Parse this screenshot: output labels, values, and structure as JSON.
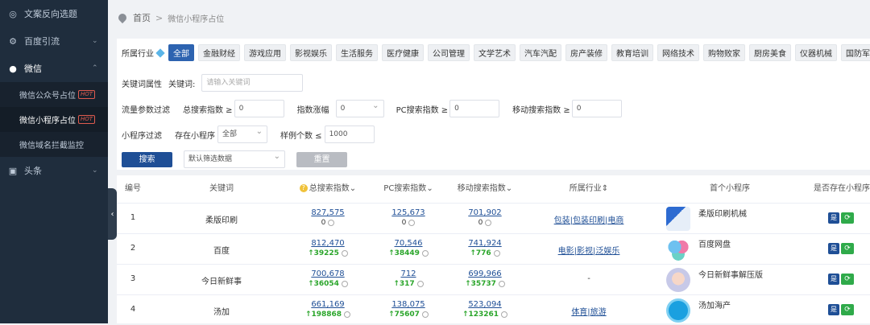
{
  "sidebar": {
    "items": [
      {
        "label": "文案反向选题",
        "icon": "target-icon"
      },
      {
        "label": "百度引流",
        "icon": "gear-icon"
      },
      {
        "label": "微信",
        "icon": "chat-icon"
      },
      {
        "label": "头条",
        "icon": "card-icon"
      }
    ],
    "wechat_sub": [
      {
        "label": "微信公众号占位",
        "badge": "HOT"
      },
      {
        "label": "微信小程序占位",
        "badge": "HOT"
      },
      {
        "label": "微信域名拦截监控"
      }
    ]
  },
  "breadcrumb": {
    "home": "首页",
    "sep": ">",
    "current": "微信小程序占位"
  },
  "filters": {
    "industry_label": "所属行业",
    "industries": [
      "全部",
      "金融财经",
      "游戏应用",
      "影视娱乐",
      "生活服务",
      "医疗健康",
      "公司管理",
      "文学艺术",
      "汽车汽配",
      "房产装修",
      "教育培训",
      "网络技术",
      "购物败家",
      "厨房美食",
      "仪器机械",
      "国防军事"
    ],
    "active_industry": "全部",
    "keyword_attr_label": "关键词属性",
    "keyword_label": "关键词:",
    "keyword_placeholder": "请输入关键词",
    "traffic_label": "流量参数过滤",
    "total_index_label": "总搜索指数 ≥",
    "total_index_value": "0",
    "index_change_label": "指数涨幅",
    "index_change_value": "0",
    "pc_index_label": "PC搜索指数 ≥",
    "pc_index_value": "0",
    "mobile_index_label": "移动搜索指数 ≥",
    "mobile_index_value": "0",
    "mini_filter_label": "小程序过滤",
    "exists_label": "存在小程序",
    "exists_value": "全部",
    "sample_label": "样例个数 ≤",
    "sample_value": "1000",
    "search_button": "搜索",
    "sort_value": "默认筛选数据",
    "reset_button": "重置"
  },
  "table": {
    "headers": [
      "编号",
      "关键词",
      "总搜索指数",
      "PC搜索指数",
      "移动搜索指数",
      "所属行业",
      "首个小程序",
      "是否存在小程序"
    ],
    "rows": [
      {
        "no": "1",
        "keyword": "柔版印刷",
        "total": "827,575",
        "total_change": "0",
        "pc": "125,673",
        "pc_change": "0",
        "mobile": "701,902",
        "mobile_change": "0",
        "industry": "包装|包装印刷|电商",
        "app": "柔版印刷机械",
        "exists": "是"
      },
      {
        "no": "2",
        "keyword": "百度",
        "total": "812,470",
        "total_change": "↑39225",
        "pc": "70,546",
        "pc_change": "↑38449",
        "mobile": "741,924",
        "mobile_change": "↑776",
        "industry": "电影|影视|泛娱乐",
        "app": "百度网盘",
        "exists": "是"
      },
      {
        "no": "3",
        "keyword": "今日新鲜事",
        "total": "700,678",
        "total_change": "↑36054",
        "pc": "712",
        "pc_change": "↑317",
        "mobile": "699,966",
        "mobile_change": "↑35737",
        "industry": "-",
        "app": "今日新鲜事解压版",
        "exists": "是"
      },
      {
        "no": "4",
        "keyword": "汤加",
        "total": "661,169",
        "total_change": "↑198868",
        "pc": "138,075",
        "pc_change": "↑75607",
        "mobile": "523,094",
        "mobile_change": "↑123261",
        "industry": "体育|旅游",
        "app": "汤加海产",
        "exists": "是"
      }
    ]
  }
}
